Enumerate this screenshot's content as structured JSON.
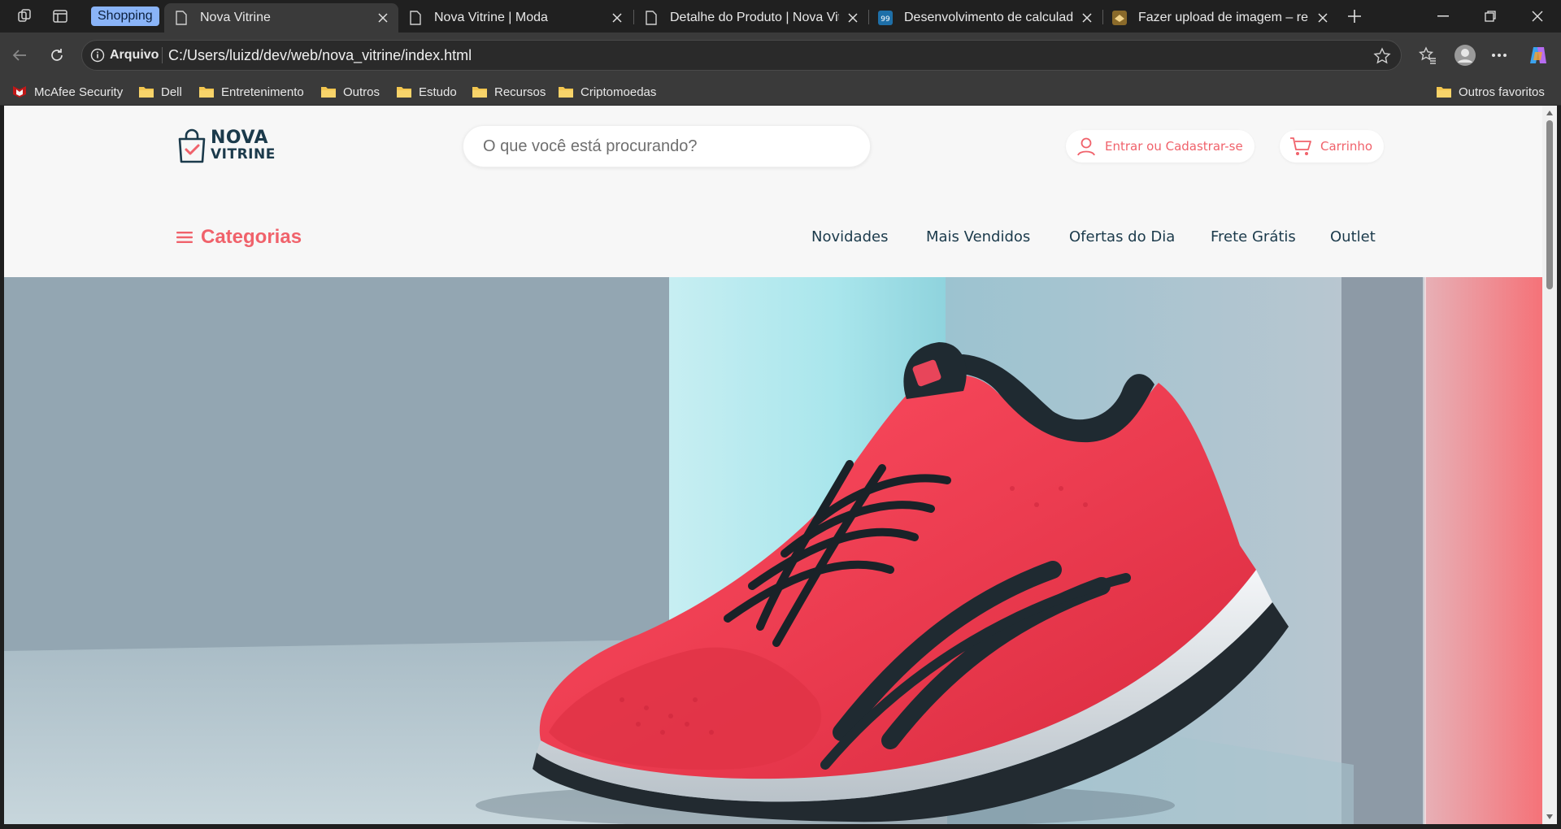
{
  "browser": {
    "shopping_badge": "Shopping",
    "tabs": [
      {
        "title": "Nova Vitrine",
        "active": true
      },
      {
        "title": "Nova Vitrine | Moda",
        "active": false
      },
      {
        "title": "Detalhe do Produto | Nova Vitrine",
        "active": false
      },
      {
        "title": "Desenvolvimento de calculadora",
        "active": false
      },
      {
        "title": "Fazer upload de imagem – remove",
        "active": false
      }
    ],
    "address": {
      "scheme_label": "Arquivo",
      "url": "C:/Users/luizd/dev/web/nova_vitrine/index.html"
    },
    "bookmarks": [
      {
        "label": "McAfee Security",
        "icon": "mcafee-icon"
      },
      {
        "label": "Dell",
        "icon": "folder-icon"
      },
      {
        "label": "Entretenimento",
        "icon": "folder-icon"
      },
      {
        "label": "Outros",
        "icon": "folder-icon"
      },
      {
        "label": "Estudo",
        "icon": "folder-icon"
      },
      {
        "label": "Recursos",
        "icon": "folder-icon"
      },
      {
        "label": "Criptomoedas",
        "icon": "folder-icon"
      }
    ],
    "other_favorites": "Outros favoritos"
  },
  "site": {
    "logo": {
      "line1": "NOVA",
      "line2": "VITRINE"
    },
    "search": {
      "placeholder": "O que você está procurando?",
      "value": ""
    },
    "login_label": "Entrar ou Cadastrar-se",
    "cart_label": "Carrinho",
    "categories_label": "Categorias",
    "nav": [
      "Novidades",
      "Mais Vendidos",
      "Ofertas do Dia",
      "Frete Grátis",
      "Outlet"
    ],
    "colors": {
      "accent": "#f0626b",
      "brand_dark": "#1b3a4b",
      "background": "#f7f7f7"
    },
    "hero": {
      "image": "red-running-shoe-photo"
    }
  }
}
